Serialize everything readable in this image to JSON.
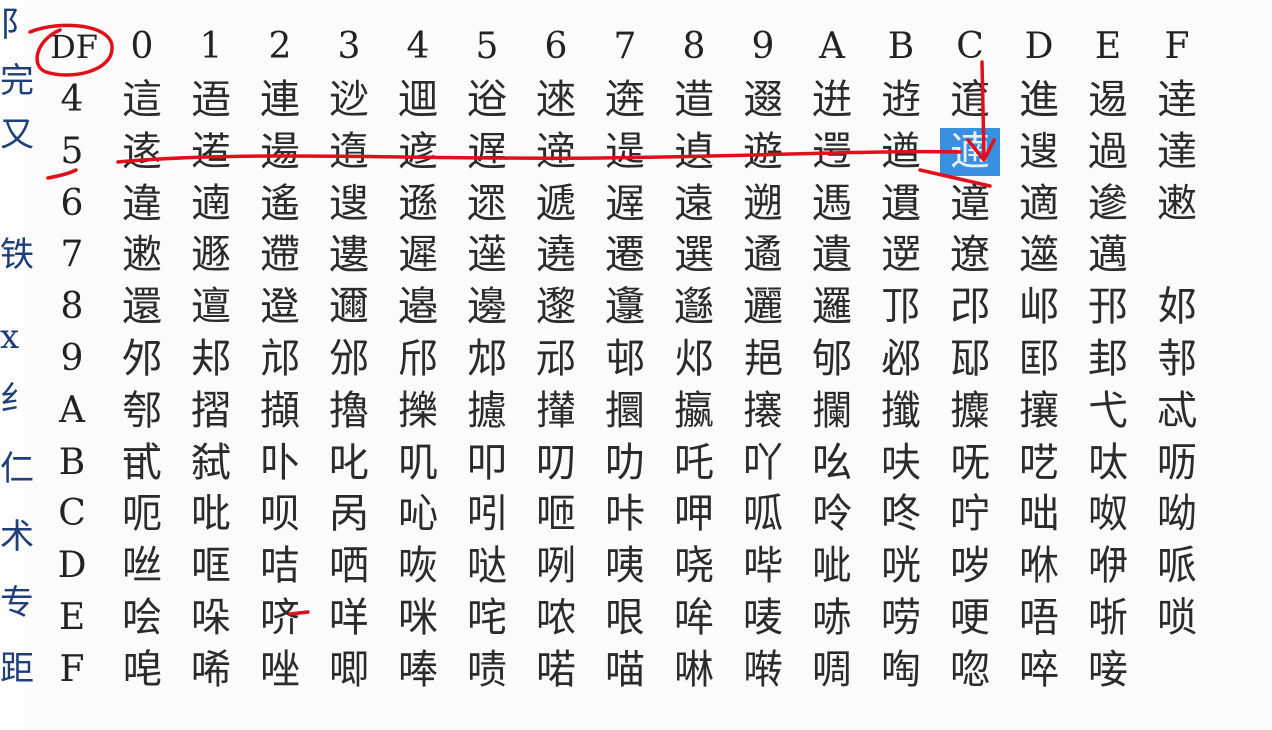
{
  "left_strip": [
    "阝",
    "完",
    "又",
    "",
    "铁",
    "x",
    "纟",
    "仁",
    "术",
    "专",
    "距"
  ],
  "table": {
    "corner": "DF",
    "column_headers": [
      "0",
      "1",
      "2",
      "3",
      "4",
      "5",
      "6",
      "7",
      "8",
      "9",
      "A",
      "B",
      "C",
      "D",
      "E",
      "F"
    ],
    "row_labels": [
      "4",
      "5",
      "6",
      "7",
      "8",
      "9",
      "A",
      "B",
      "C",
      "D",
      "E",
      "F"
    ],
    "rows": [
      [
        "這",
        "逜",
        "連",
        "逤",
        "逥",
        "逧",
        "逨",
        "逩",
        "逪",
        "逫",
        "逬",
        "逰",
        "逳",
        "進",
        "逷",
        "逹"
      ],
      [
        "逺",
        "逽",
        "逿",
        "遀",
        "遃",
        "遅",
        "遆",
        "遈",
        "遉",
        "遊",
        "遌",
        "遒",
        "遖",
        "遚",
        "過",
        "達"
      ],
      [
        "違",
        "遖",
        "遙",
        "遚",
        "遜",
        "遝",
        "遞",
        "遟",
        "遠",
        "遡",
        "遤",
        "遦",
        "遧",
        "適",
        "遪",
        "遫"
      ],
      [
        "遬",
        "遯",
        "遰",
        "遱",
        "遲",
        "遳",
        "遶",
        "遷",
        "選",
        "遹",
        "遺",
        "遻",
        "遼",
        "遾",
        "邁",
        ""
      ],
      [
        "還",
        "邅",
        "邆",
        "邇",
        "邉",
        "邊",
        "邌",
        "邍",
        "邎",
        "邐",
        "邏",
        "邒",
        "邔",
        "邖",
        "邘",
        "邚"
      ],
      [
        "邜",
        "邞",
        "邟",
        "邠",
        "邤",
        "邥",
        "邧",
        "邨",
        "邩",
        "邫",
        "邭",
        "邲",
        "邷",
        "邼",
        "邽",
        "邿"
      ],
      [
        "郀",
        "摺",
        "擷",
        "擼",
        "擽",
        "攄",
        "攆",
        "攌",
        "攍",
        "攐",
        "攔",
        "攕",
        "攗",
        "攘",
        "弋",
        "忒"
      ],
      [
        "甙",
        "弑",
        "卟",
        "叱",
        "叽",
        "叩",
        "叨",
        "叻",
        "吒",
        "吖",
        "吆",
        "呋",
        "呒",
        "呓",
        "呔",
        "呖"
      ],
      [
        "呃",
        "吡",
        "呗",
        "呙",
        "吣",
        "吲",
        "咂",
        "咔",
        "呷",
        "呱",
        "呤",
        "咚",
        "咛",
        "咄",
        "呶",
        "呦"
      ],
      [
        "咝",
        "哐",
        "咭",
        "哂",
        "咴",
        "哒",
        "咧",
        "咦",
        "哓",
        "哔",
        "呲",
        "咣",
        "哕",
        "咻",
        "咿",
        "哌"
      ],
      [
        "哙",
        "哚",
        "哜",
        "咩",
        "咪",
        "咤",
        "哝",
        "哏",
        "哞",
        "唛",
        "哧",
        "唠",
        "哽",
        "唔",
        "哳",
        "唢"
      ],
      [
        "唣",
        "唏",
        "唑",
        "唧",
        "唪",
        "啧",
        "喏",
        "喵",
        "啉",
        "啭",
        "啁",
        "啕",
        "唿",
        "啐",
        "唼",
        ""
      ]
    ],
    "selected_cell": {
      "row": "5",
      "col": "C",
      "char": "遖"
    }
  },
  "annotation": {
    "ink_color": "#e0101a"
  }
}
